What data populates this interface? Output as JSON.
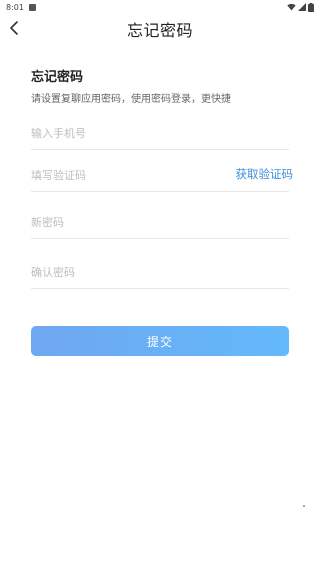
{
  "status_bar": {
    "time": "8:01"
  },
  "header": {
    "title": "忘记密码"
  },
  "form": {
    "title": "忘记密码",
    "subtitle": "请设置复聊应用密码，使用密码登录，更快捷",
    "phone_placeholder": "输入手机号",
    "code_placeholder": "填写验证码",
    "get_code_label": "获取验证码",
    "new_password_placeholder": "新密码",
    "confirm_password_placeholder": "确认密码",
    "submit_label": "提交"
  },
  "colors": {
    "accent": "#3c8fd8",
    "button_gradient_start": "#6fa7f0",
    "button_gradient_end": "#63b9fb"
  }
}
